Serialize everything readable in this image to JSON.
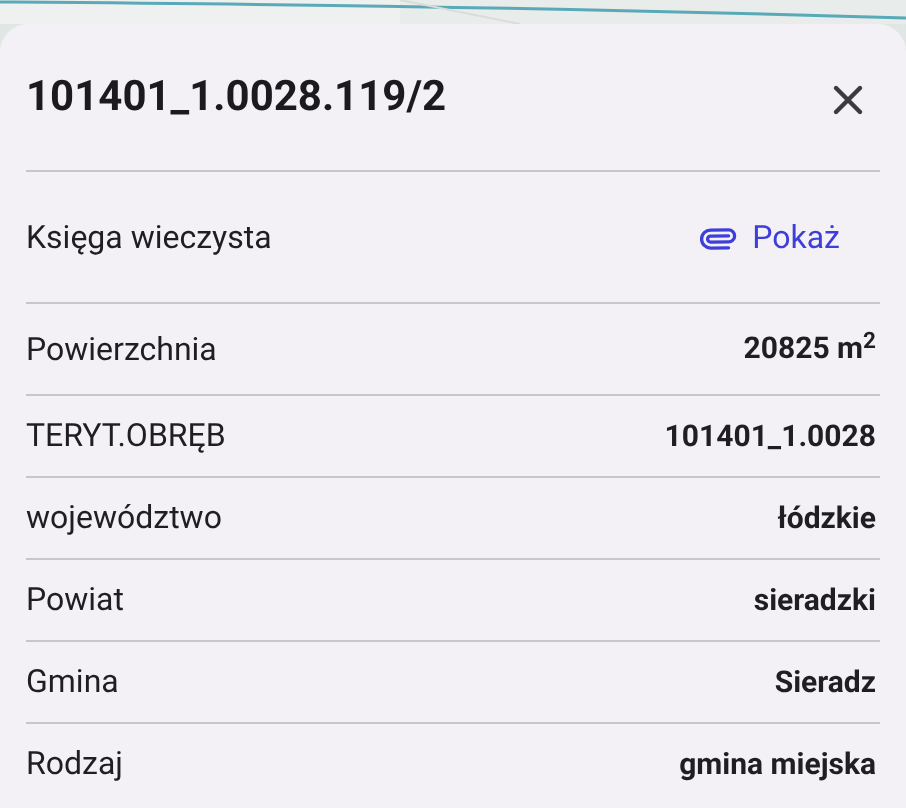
{
  "panel": {
    "title": "101401_1.0028.119/2"
  },
  "rows": [
    {
      "kind": "link",
      "label": "Księga wieczysta",
      "value": "Pokaż"
    },
    {
      "kind": "value",
      "label": "Powierzchnia",
      "value": "20825 m$^{2}$"
    },
    {
      "kind": "value",
      "label": "TERYT.OBRĘB",
      "value": "101401_1.0028"
    },
    {
      "kind": "value",
      "label": "województwo",
      "value": "łódzkie"
    },
    {
      "kind": "value",
      "label": "Powiat",
      "value": "sieradzki"
    },
    {
      "kind": "value",
      "label": "Gmina",
      "value": "Sieradz"
    },
    {
      "kind": "value",
      "label": "Rodzaj",
      "value": "gmina miejska"
    }
  ]
}
